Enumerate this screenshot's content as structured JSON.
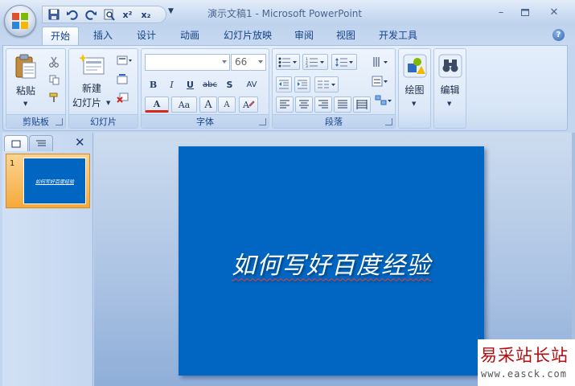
{
  "window": {
    "title": "演示文稿1 - Microsoft PowerPoint",
    "controls": [
      "minimize-icon",
      "maximize-icon",
      "close-icon"
    ]
  },
  "quick_access": {
    "buttons": [
      "save-icon",
      "undo-icon",
      "redo-icon",
      "print-preview-icon",
      "superscript-icon",
      "subscript-icon"
    ],
    "superscript_label": "x²",
    "subscript_label": "x₂"
  },
  "tabs": [
    {
      "label": "开始",
      "active": true
    },
    {
      "label": "插入"
    },
    {
      "label": "设计"
    },
    {
      "label": "动画"
    },
    {
      "label": "幻灯片放映"
    },
    {
      "label": "审阅"
    },
    {
      "label": "视图"
    },
    {
      "label": "开发工具"
    }
  ],
  "help_label": "?",
  "ribbon": {
    "clipboard": {
      "label": "剪贴板",
      "paste_label": "粘贴"
    },
    "slides": {
      "label": "幻灯片",
      "new_slide_line1": "新建",
      "new_slide_line2": "幻灯片"
    },
    "font": {
      "label": "字体",
      "font_name": "",
      "font_size": "66",
      "bold": "B",
      "italic": "I",
      "underline": "U",
      "strike": "abc",
      "shadow": "S",
      "spacing": "AV",
      "font_color": "A",
      "change_case": "Aa",
      "grow": "A",
      "shrink": "A"
    },
    "paragraph": {
      "label": "段落"
    },
    "drawing": {
      "label": "绘图"
    },
    "editing": {
      "label": "编辑"
    }
  },
  "slide_pane": {
    "thumb_number": "1",
    "thumb_text": "如何写好百度经验"
  },
  "slide": {
    "title": "如何写好百度经验",
    "background": "#0066c2"
  },
  "watermark": {
    "text_cn": "易采站长站",
    "url": "www.easck.com"
  },
  "colors": {
    "accent": "#15428b",
    "ribbon_bg": "#dce8f8",
    "thumb_highlight": "#f6a93c"
  }
}
